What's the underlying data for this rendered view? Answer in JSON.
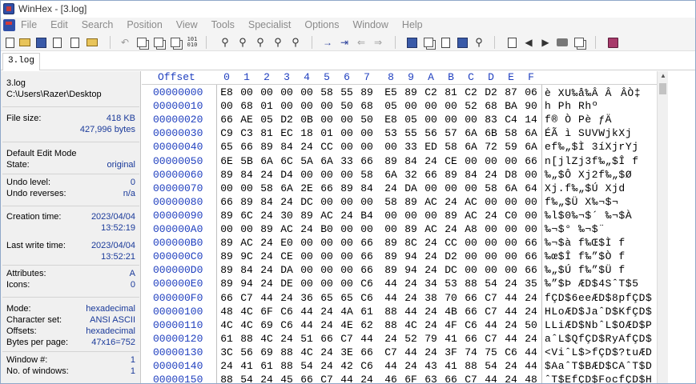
{
  "window": {
    "title": "WinHex - [3.log]"
  },
  "menu": [
    "File",
    "Edit",
    "Search",
    "Position",
    "View",
    "Tools",
    "Specialist",
    "Options",
    "Window",
    "Help"
  ],
  "tab": {
    "label": "3.log"
  },
  "info": {
    "file_name": "3.log",
    "path": "C:\\Users\\Razer\\Desktop",
    "file_size_label": "File size:",
    "file_size_kb": "418 KB",
    "file_size_bytes": "427,996 bytes",
    "edit_mode_label": "Default Edit Mode",
    "state_label": "State:",
    "state_value": "original",
    "undo_level_label": "Undo level:",
    "undo_level_value": "0",
    "undo_reverses_label": "Undo reverses:",
    "undo_reverses_value": "n/a",
    "creation_time_label": "Creation time:",
    "creation_date": "2023/04/04",
    "creation_time": "13:52:19",
    "last_write_label": "Last write time:",
    "last_write_date": "2023/04/04",
    "last_write_time": "13:52:21",
    "attributes_label": "Attributes:",
    "attributes_value": "A",
    "icons_label": "Icons:",
    "icons_value": "0",
    "mode_label": "Mode:",
    "mode_value": "hexadecimal",
    "charset_label": "Character set:",
    "charset_value": "ANSI ASCII",
    "offsets_label": "Offsets:",
    "offsets_value": "hexadecimal",
    "bytes_per_page_label": "Bytes per page:",
    "bytes_per_page_value": "47x16=752",
    "window_num_label": "Window #:",
    "window_num_value": "1",
    "num_windows_label": "No. of windows:",
    "num_windows_value": "1"
  },
  "hex": {
    "offset_header": "Offset",
    "columns": [
      "0",
      "1",
      "2",
      "3",
      "4",
      "5",
      "6",
      "7",
      "8",
      "9",
      "A",
      "B",
      "C",
      "D",
      "E",
      "F"
    ],
    "rows": [
      {
        "offset": "00000000",
        "bytes": [
          "E8",
          "00",
          "00",
          "00",
          "00",
          "58",
          "55",
          "89",
          "E5",
          "89",
          "C2",
          "81",
          "C2",
          "D2",
          "87",
          "06"
        ],
        "text": "è    XU‰å‰Â ÂÂÒ‡"
      },
      {
        "offset": "00000010",
        "bytes": [
          "00",
          "68",
          "01",
          "00",
          "00",
          "00",
          "50",
          "68",
          "05",
          "00",
          "00",
          "00",
          "52",
          "68",
          "BA",
          "90"
        ],
        "text": " h    Ph    Rhº"
      },
      {
        "offset": "00000020",
        "bytes": [
          "66",
          "AE",
          "05",
          "D2",
          "0B",
          "00",
          "00",
          "50",
          "E8",
          "05",
          "00",
          "00",
          "00",
          "83",
          "C4",
          "14"
        ],
        "text": "f® Ò   Pè    ƒÄ"
      },
      {
        "offset": "00000030",
        "bytes": [
          "C9",
          "C3",
          "81",
          "EC",
          "18",
          "01",
          "00",
          "00",
          "53",
          "55",
          "56",
          "57",
          "6A",
          "6B",
          "58",
          "6A"
        ],
        "text": "ÉÃ ì    SUVWjkXj"
      },
      {
        "offset": "00000040",
        "bytes": [
          "65",
          "66",
          "89",
          "84",
          "24",
          "CC",
          "00",
          "00",
          "00",
          "33",
          "ED",
          "58",
          "6A",
          "72",
          "59",
          "6A"
        ],
        "text": "ef‰„$Ì   3íXjrYj"
      },
      {
        "offset": "00000050",
        "bytes": [
          "6E",
          "5B",
          "6A",
          "6C",
          "5A",
          "6A",
          "33",
          "66",
          "89",
          "84",
          "24",
          "CE",
          "00",
          "00",
          "00",
          "66"
        ],
        "text": "n[jlZj3f‰„$Î   f"
      },
      {
        "offset": "00000060",
        "bytes": [
          "89",
          "84",
          "24",
          "D4",
          "00",
          "00",
          "00",
          "58",
          "6A",
          "32",
          "66",
          "89",
          "84",
          "24",
          "D8",
          "00"
        ],
        "text": "‰„$Ô   Xj2f‰„$Ø"
      },
      {
        "offset": "00000070",
        "bytes": [
          "00",
          "00",
          "58",
          "6A",
          "2E",
          "66",
          "89",
          "84",
          "24",
          "DA",
          "00",
          "00",
          "00",
          "58",
          "6A",
          "64"
        ],
        "text": "  Xj.f‰„$Ú   Xjd"
      },
      {
        "offset": "00000080",
        "bytes": [
          "66",
          "89",
          "84",
          "24",
          "DC",
          "00",
          "00",
          "00",
          "58",
          "89",
          "AC",
          "24",
          "AC",
          "00",
          "00",
          "00"
        ],
        "text": "f‰„$Ü   X‰¬$¬"
      },
      {
        "offset": "00000090",
        "bytes": [
          "89",
          "6C",
          "24",
          "30",
          "89",
          "AC",
          "24",
          "B4",
          "00",
          "00",
          "00",
          "89",
          "AC",
          "24",
          "C0",
          "00"
        ],
        "text": "‰l$0‰¬$´   ‰¬$À"
      },
      {
        "offset": "000000A0",
        "bytes": [
          "00",
          "00",
          "89",
          "AC",
          "24",
          "B0",
          "00",
          "00",
          "00",
          "89",
          "AC",
          "24",
          "A8",
          "00",
          "00",
          "00"
        ],
        "text": "  ‰¬$°   ‰¬$¨"
      },
      {
        "offset": "000000B0",
        "bytes": [
          "89",
          "AC",
          "24",
          "E0",
          "00",
          "00",
          "00",
          "66",
          "89",
          "8C",
          "24",
          "CC",
          "00",
          "00",
          "00",
          "66"
        ],
        "text": "‰¬$à   f‰Œ$Ì   f"
      },
      {
        "offset": "000000C0",
        "bytes": [
          "89",
          "9C",
          "24",
          "CE",
          "00",
          "00",
          "00",
          "66",
          "89",
          "94",
          "24",
          "D2",
          "00",
          "00",
          "00",
          "66"
        ],
        "text": "‰œ$Î   f‰”$Ò   f"
      },
      {
        "offset": "000000D0",
        "bytes": [
          "89",
          "84",
          "24",
          "DA",
          "00",
          "00",
          "00",
          "66",
          "89",
          "94",
          "24",
          "DC",
          "00",
          "00",
          "00",
          "66"
        ],
        "text": "‰„$Ú   f‰”$Ü   f"
      },
      {
        "offset": "000000E0",
        "bytes": [
          "89",
          "94",
          "24",
          "DE",
          "00",
          "00",
          "00",
          "C6",
          "44",
          "24",
          "34",
          "53",
          "88",
          "54",
          "24",
          "35"
        ],
        "text": "‰”$Þ   ÆD$4SˆT$5"
      },
      {
        "offset": "000000F0",
        "bytes": [
          "66",
          "C7",
          "44",
          "24",
          "36",
          "65",
          "65",
          "C6",
          "44",
          "24",
          "38",
          "70",
          "66",
          "C7",
          "44",
          "24"
        ],
        "text": "fÇD$6eeÆD$8pfÇD$"
      },
      {
        "offset": "00000100",
        "bytes": [
          "48",
          "4C",
          "6F",
          "C6",
          "44",
          "24",
          "4A",
          "61",
          "88",
          "44",
          "24",
          "4B",
          "66",
          "C7",
          "44",
          "24"
        ],
        "text": "HLoÆD$JaˆD$KfÇD$"
      },
      {
        "offset": "00000110",
        "bytes": [
          "4C",
          "4C",
          "69",
          "C6",
          "44",
          "24",
          "4E",
          "62",
          "88",
          "4C",
          "24",
          "4F",
          "C6",
          "44",
          "24",
          "50"
        ],
        "text": "LLiÆD$NbˆL$OÆD$P"
      },
      {
        "offset": "00000120",
        "bytes": [
          "61",
          "88",
          "4C",
          "24",
          "51",
          "66",
          "C7",
          "44",
          "24",
          "52",
          "79",
          "41",
          "66",
          "C7",
          "44",
          "24"
        ],
        "text": "aˆL$QfÇD$RyAfÇD$"
      },
      {
        "offset": "00000130",
        "bytes": [
          "3C",
          "56",
          "69",
          "88",
          "4C",
          "24",
          "3E",
          "66",
          "C7",
          "44",
          "24",
          "3F",
          "74",
          "75",
          "C6",
          "44"
        ],
        "text": "<ViˆL$>fÇD$?tuÆD"
      },
      {
        "offset": "00000140",
        "bytes": [
          "24",
          "41",
          "61",
          "88",
          "54",
          "24",
          "42",
          "C6",
          "44",
          "24",
          "43",
          "41",
          "88",
          "54",
          "24",
          "44"
        ],
        "text": "$AaˆT$BÆD$CAˆT$D"
      },
      {
        "offset": "00000150",
        "bytes": [
          "88",
          "54",
          "24",
          "45",
          "66",
          "C7",
          "44",
          "24",
          "46",
          "6F",
          "63",
          "66",
          "C7",
          "44",
          "24",
          "48"
        ],
        "text": "ˆT$EfÇD$FocfÇD$H"
      }
    ]
  }
}
